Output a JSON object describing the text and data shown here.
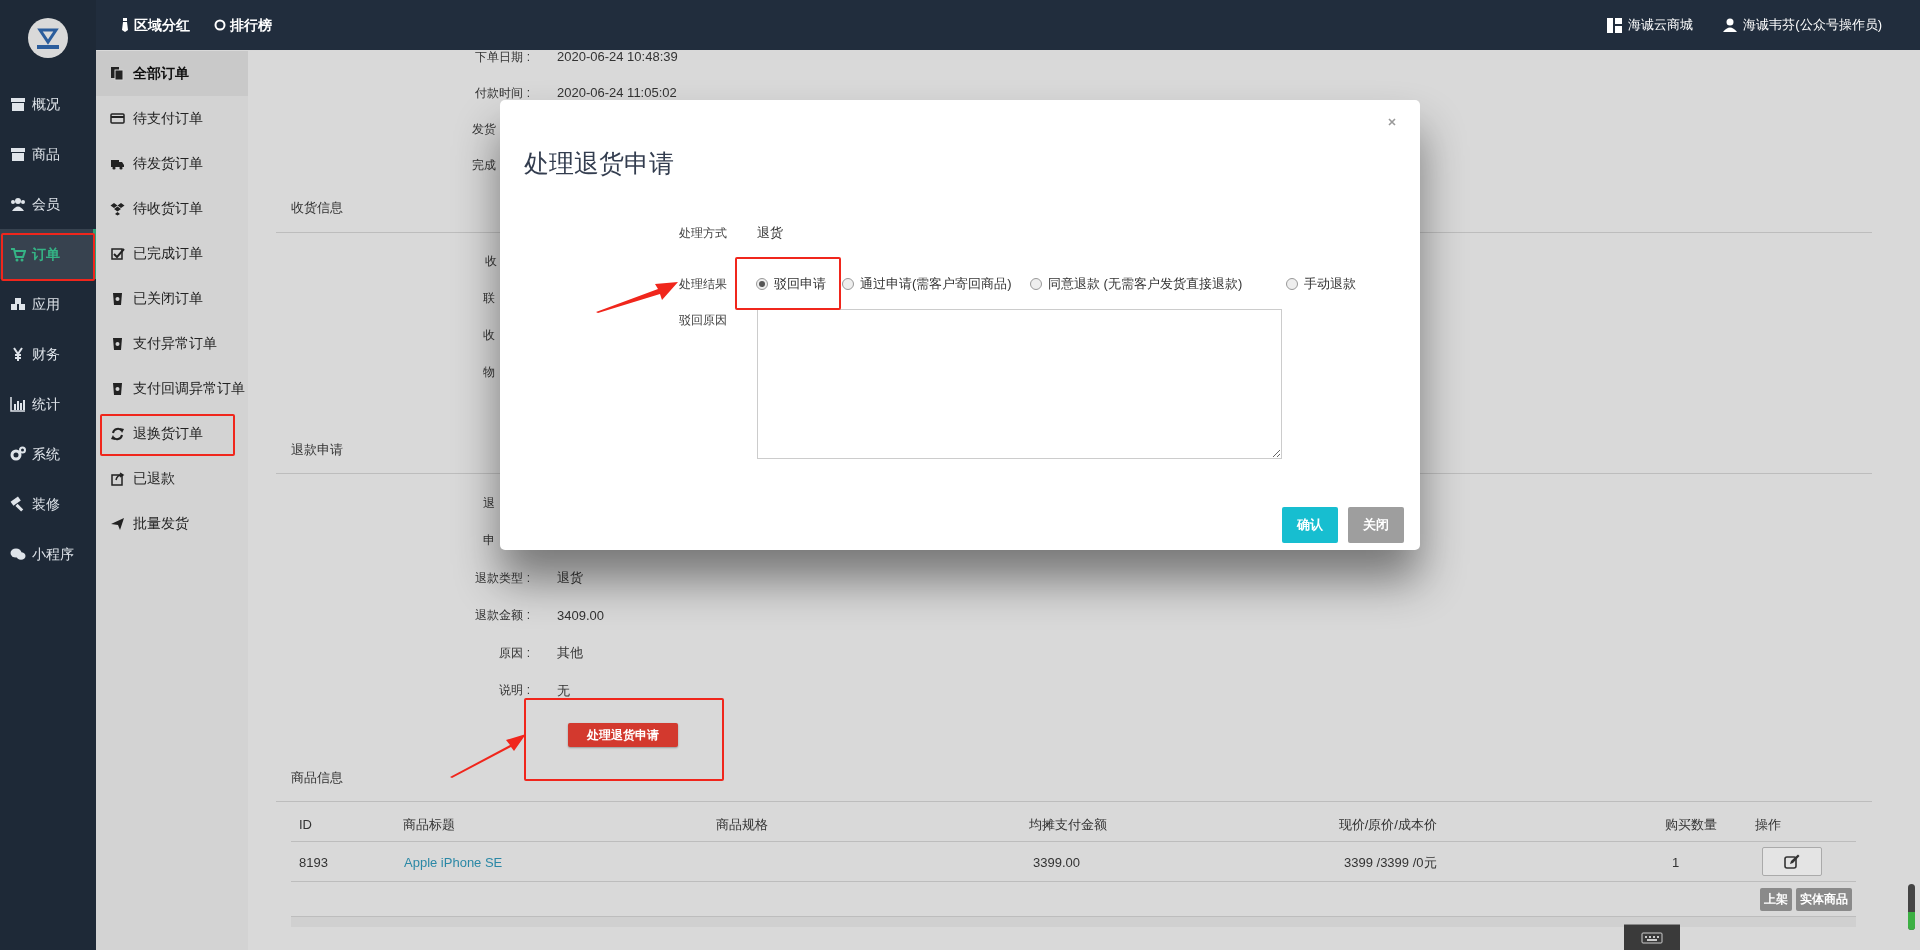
{
  "topbar": {
    "links": [
      {
        "label": "区域分红"
      },
      {
        "label": "排行榜"
      }
    ],
    "right": [
      {
        "label": "海诚云商城"
      },
      {
        "label": "海诚韦芬(公众号操作员)"
      }
    ]
  },
  "sidebar": {
    "items": [
      {
        "label": "概况",
        "selected": false
      },
      {
        "label": "商品",
        "selected": false
      },
      {
        "label": "会员",
        "selected": false
      },
      {
        "label": "订单",
        "selected": true
      },
      {
        "label": "应用",
        "selected": false
      },
      {
        "label": "财务",
        "selected": false
      },
      {
        "label": "统计",
        "selected": false
      },
      {
        "label": "系统",
        "selected": false
      },
      {
        "label": "装修",
        "selected": false
      },
      {
        "label": "小程序",
        "selected": false
      }
    ]
  },
  "submenu": {
    "items": [
      {
        "label": "全部订单",
        "selected": true
      },
      {
        "label": "待支付订单",
        "selected": false
      },
      {
        "label": "待发货订单",
        "selected": false
      },
      {
        "label": "待收货订单",
        "selected": false
      },
      {
        "label": "已完成订单",
        "selected": false
      },
      {
        "label": "已关闭订单",
        "selected": false
      },
      {
        "label": "支付异常订单",
        "selected": false
      },
      {
        "label": "支付回调异常订单",
        "selected": false
      },
      {
        "label": "退换货订单",
        "selected": false
      },
      {
        "label": "已退款",
        "selected": false
      },
      {
        "label": "批量发货",
        "selected": false
      }
    ]
  },
  "order_times": [
    {
      "label": "下单日期 :",
      "value": "2020-06-24 10:48:39"
    },
    {
      "label": "付款时间 :",
      "value": "2020-06-24 11:05:02"
    },
    {
      "label": "发货"
    },
    {
      "label": "完成"
    }
  ],
  "shipping": {
    "title": "收货信息",
    "rows": [
      {
        "label": "收"
      },
      {
        "label": "联"
      },
      {
        "label": "收"
      },
      {
        "label": "物"
      }
    ]
  },
  "refund": {
    "title": "退款申请",
    "rows": [
      {
        "label": "退"
      },
      {
        "label": "申"
      },
      {
        "label": "退款类型 :",
        "value": "退货"
      },
      {
        "label": "退款金额 :",
        "value": "3409.00"
      },
      {
        "label": "原因 :",
        "value": "其他"
      },
      {
        "label": "说明 :",
        "value": "无"
      }
    ],
    "button": "处理退货申请"
  },
  "products": {
    "title": "商品信息",
    "columns": [
      "ID",
      "商品标题",
      "商品规格",
      "均摊支付金额",
      "现价/原价/成本价",
      "购买数量",
      "操作"
    ],
    "rows": [
      {
        "id": "8193",
        "title": "Apple iPhone SE",
        "pay": "3399.00",
        "price": "3399 /3399 /0元",
        "qty": "1",
        "tags": [
          "上架",
          "实体商品"
        ]
      }
    ]
  },
  "modal": {
    "title": "处理退货申请",
    "method_label": "处理方式",
    "method": "退货",
    "result_label": "处理结果",
    "results": [
      {
        "label": "驳回申请",
        "selected": true
      },
      {
        "label": "通过申请(需客户寄回商品)",
        "selected": false
      },
      {
        "label": "同意退款 (无需客户发货直接退款)",
        "selected": false
      },
      {
        "label": "手动退款",
        "selected": false
      }
    ],
    "reason_label": "驳回原因",
    "buttons": [
      {
        "label": "确认",
        "kind": "primary"
      },
      {
        "label": "关闭",
        "kind": "secondary"
      }
    ]
  }
}
